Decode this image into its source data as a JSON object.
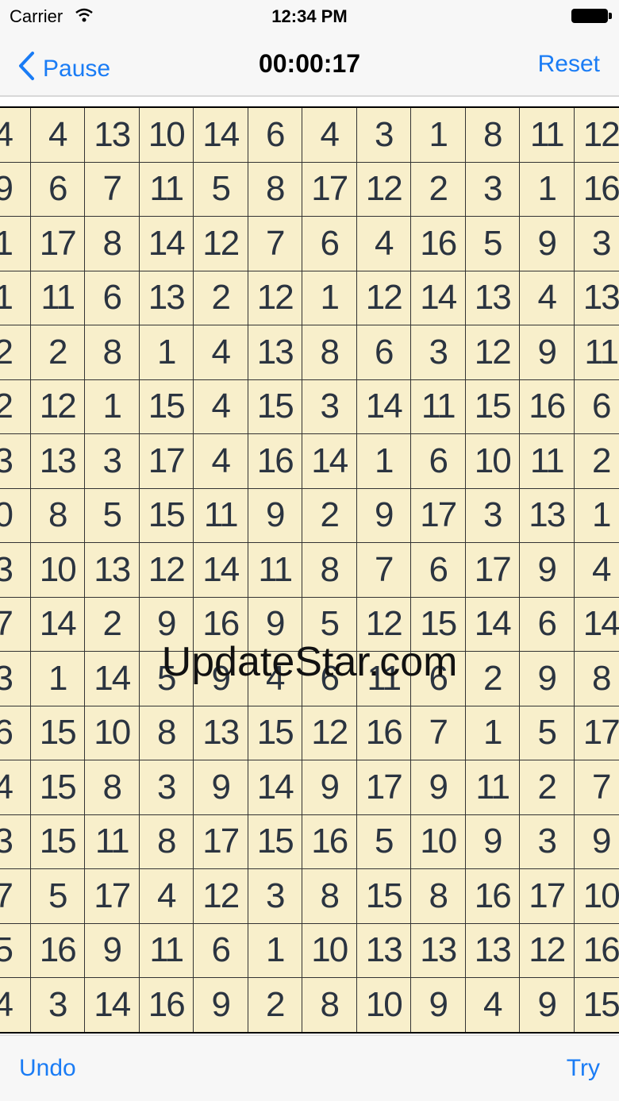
{
  "status": {
    "carrier": "Carrier",
    "time": "12:34 PM"
  },
  "nav": {
    "back_label": "Pause",
    "title": "00:00:17",
    "right_label": "Reset"
  },
  "grid": {
    "rows": [
      [
        "4",
        "4",
        "13",
        "10",
        "14",
        "6",
        "4",
        "3",
        "1",
        "8",
        "11",
        "12"
      ],
      [
        "9",
        "6",
        "7",
        "11",
        "5",
        "8",
        "17",
        "12",
        "2",
        "3",
        "1",
        "16"
      ],
      [
        "1",
        "17",
        "8",
        "14",
        "12",
        "7",
        "6",
        "4",
        "16",
        "5",
        "9",
        "3"
      ],
      [
        "1",
        "11",
        "6",
        "13",
        "2",
        "12",
        "1",
        "12",
        "14",
        "13",
        "4",
        "13"
      ],
      [
        "2",
        "2",
        "8",
        "1",
        "4",
        "13",
        "8",
        "6",
        "3",
        "12",
        "9",
        "11"
      ],
      [
        "2",
        "12",
        "1",
        "15",
        "4",
        "15",
        "3",
        "14",
        "11",
        "15",
        "16",
        "6"
      ],
      [
        "3",
        "13",
        "3",
        "17",
        "4",
        "16",
        "14",
        "1",
        "6",
        "10",
        "11",
        "2"
      ],
      [
        "0",
        "8",
        "5",
        "15",
        "11",
        "9",
        "2",
        "9",
        "17",
        "3",
        "13",
        "1"
      ],
      [
        "3",
        "10",
        "13",
        "12",
        "14",
        "11",
        "8",
        "7",
        "6",
        "17",
        "9",
        "4"
      ],
      [
        "7",
        "14",
        "2",
        "9",
        "16",
        "9",
        "5",
        "12",
        "15",
        "14",
        "6",
        "14"
      ],
      [
        "3",
        "1",
        "14",
        "5",
        "9",
        "4",
        "6",
        "11",
        "6",
        "2",
        "9",
        "8"
      ],
      [
        "6",
        "15",
        "10",
        "8",
        "13",
        "15",
        "12",
        "16",
        "7",
        "1",
        "5",
        "17"
      ],
      [
        "4",
        "15",
        "8",
        "3",
        "9",
        "14",
        "9",
        "17",
        "9",
        "11",
        "2",
        "7"
      ],
      [
        "3",
        "15",
        "11",
        "8",
        "17",
        "15",
        "16",
        "5",
        "10",
        "9",
        "3",
        "9"
      ],
      [
        "7",
        "5",
        "17",
        "4",
        "12",
        "3",
        "8",
        "15",
        "8",
        "16",
        "17",
        "10"
      ],
      [
        "5",
        "16",
        "9",
        "11",
        "6",
        "1",
        "10",
        "13",
        "13",
        "13",
        "12",
        "16"
      ],
      [
        "4",
        "3",
        "14",
        "16",
        "9",
        "2",
        "8",
        "10",
        "9",
        "4",
        "9",
        "15"
      ]
    ]
  },
  "watermark": "UpdateStar.com",
  "toolbar": {
    "left_label": "Undo",
    "right_label": "Try"
  },
  "colors": {
    "accent": "#1a7cf5",
    "cell_bg": "#f8efcb",
    "text": "#2b3440"
  },
  "icons": {
    "back": "chevron-left-icon",
    "wifi": "wifi-icon",
    "battery": "battery-icon"
  }
}
